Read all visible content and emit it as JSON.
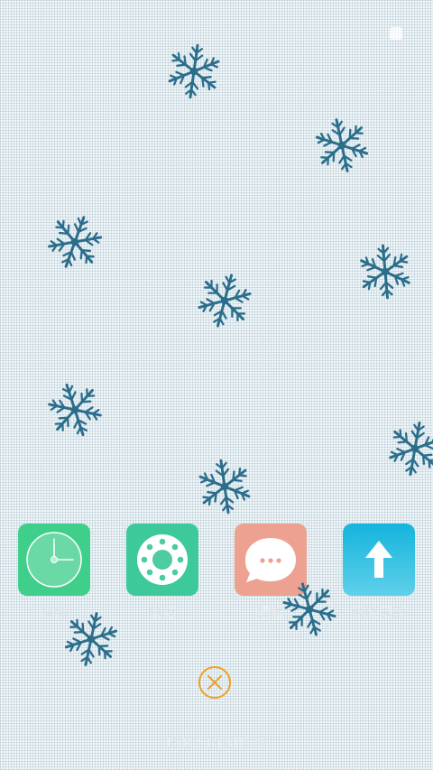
{
  "apps": [
    {
      "name": "clock",
      "label": "时钟",
      "color": "#3fcf8a"
    },
    {
      "name": "phone",
      "label": "电话",
      "color": "#3ec99a"
    },
    {
      "name": "messages",
      "label": "短信",
      "color": "#eda190"
    },
    {
      "name": "system-update",
      "label": "系统更新",
      "color": "#25bde0"
    }
  ],
  "footer": {
    "text": "1587 Draft 26"
  },
  "colors": {
    "snowflake": "#2b6e8c",
    "close_ring": "#f0a024"
  }
}
